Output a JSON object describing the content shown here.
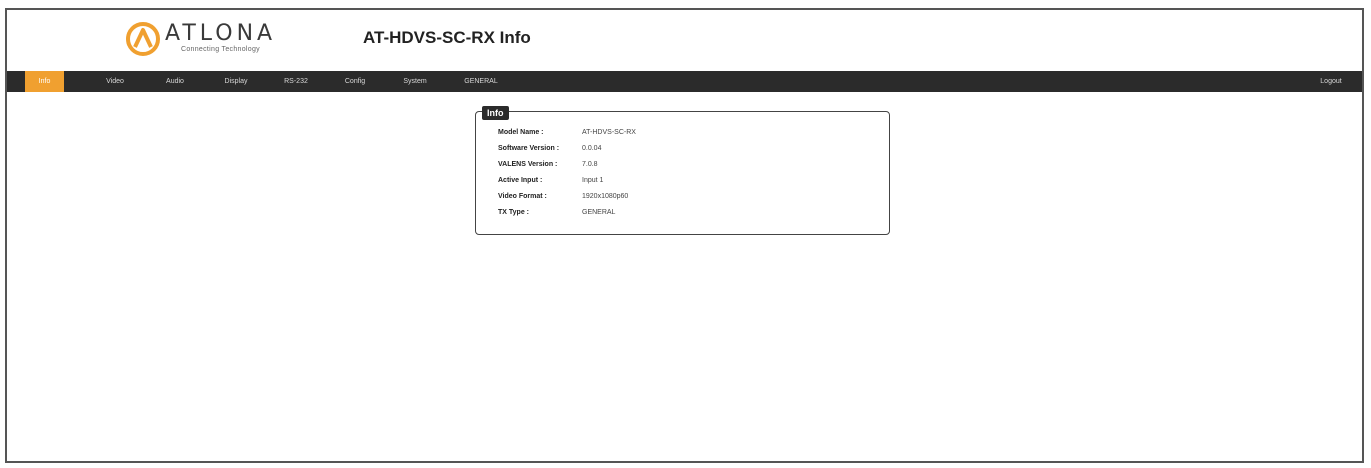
{
  "header": {
    "logo_text": "ATLONA",
    "logo_tagline": "Connecting Technology",
    "page_title": "AT-HDVS-SC-RX  Info",
    "brand_color": "#f0a030"
  },
  "nav": {
    "items": [
      {
        "label": "Info",
        "active": true
      },
      {
        "label": "Video",
        "active": false
      },
      {
        "label": "Audio",
        "active": false
      },
      {
        "label": "Display",
        "active": false
      },
      {
        "label": "RS-232",
        "active": false
      },
      {
        "label": "Config",
        "active": false
      },
      {
        "label": "System",
        "active": false
      },
      {
        "label": "GENERAL",
        "active": false
      }
    ],
    "logout_label": "Logout"
  },
  "info": {
    "legend": "Info",
    "rows": [
      {
        "label": "Model Name :",
        "value": "AT-HDVS-SC-RX"
      },
      {
        "label": "Software Version :",
        "value": "0.0.04"
      },
      {
        "label": "VALENS Version :",
        "value": "7.0.8"
      },
      {
        "label": "Active Input :",
        "value": "Input 1"
      },
      {
        "label": "Video Format :",
        "value": "1920x1080p60"
      },
      {
        "label": "TX Type :",
        "value": "GENERAL"
      }
    ]
  },
  "colors": {
    "navbar_bg": "#2b2b2b",
    "active_tab": "#f0a030"
  }
}
